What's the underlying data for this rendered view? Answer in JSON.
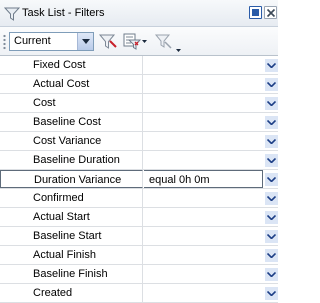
{
  "window": {
    "title": "Task List - Filters"
  },
  "toolbar": {
    "view_select": {
      "value": "Current"
    },
    "buttons": [
      {
        "name": "filter-icon"
      },
      {
        "name": "filter-options-icon"
      },
      {
        "name": "clear-filter-icon"
      }
    ]
  },
  "filters": {
    "rows": [
      {
        "field": "Fixed Cost",
        "value": ""
      },
      {
        "field": "Actual Cost",
        "value": ""
      },
      {
        "field": "Cost",
        "value": ""
      },
      {
        "field": "Baseline Cost",
        "value": ""
      },
      {
        "field": "Cost Variance",
        "value": ""
      },
      {
        "field": "Baseline Duration",
        "value": ""
      },
      {
        "field": "Duration Variance",
        "value": "equal 0h 0m",
        "active": true
      },
      {
        "field": "Confirmed",
        "value": ""
      },
      {
        "field": "Actual Start",
        "value": ""
      },
      {
        "field": "Baseline Start",
        "value": ""
      },
      {
        "field": "Actual Finish",
        "value": ""
      },
      {
        "field": "Baseline Finish",
        "value": ""
      },
      {
        "field": "Created",
        "value": ""
      }
    ]
  },
  "colors": {
    "accent": "#2a5ba8",
    "grid_line": "#dcdfe3",
    "dropdown_bg": "#dbe5f5"
  }
}
